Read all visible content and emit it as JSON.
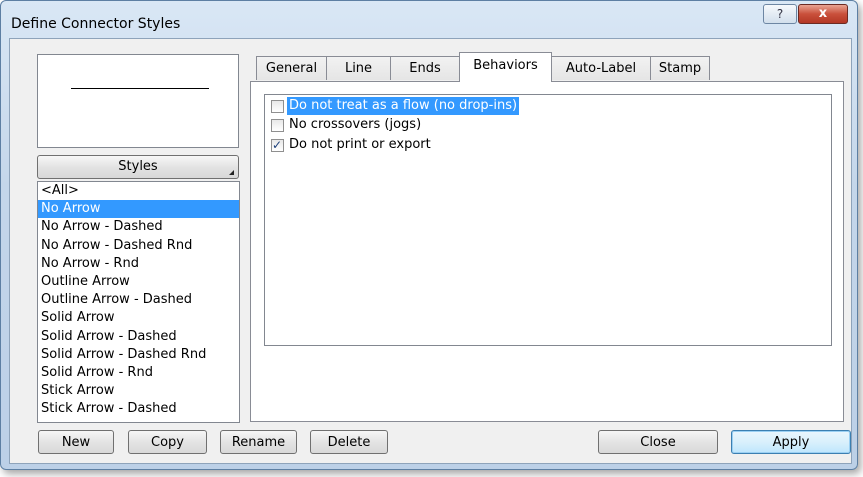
{
  "window": {
    "title": "Define Connector Styles",
    "help_glyph": "?",
    "close_glyph": "x"
  },
  "styles_button": {
    "label": "Styles"
  },
  "style_list": {
    "selected": "No Arrow",
    "items": [
      "<All>",
      "No Arrow",
      "No Arrow - Dashed",
      "No Arrow - Dashed Rnd",
      "No Arrow - Rnd",
      "Outline Arrow",
      "Outline Arrow - Dashed",
      "Solid Arrow",
      "Solid Arrow - Dashed",
      "Solid Arrow - Dashed Rnd",
      "Solid Arrow - Rnd",
      "Stick Arrow",
      "Stick Arrow - Dashed"
    ]
  },
  "tabs": [
    {
      "label": "General",
      "active": false
    },
    {
      "label": "Line",
      "active": false
    },
    {
      "label": "Ends",
      "active": false
    },
    {
      "label": "Behaviors",
      "active": true
    },
    {
      "label": "Auto-Label",
      "active": false
    },
    {
      "label": "Stamp",
      "active": false
    }
  ],
  "behaviors": [
    {
      "label": "Do not treat as a flow (no drop-ins)",
      "checked": false,
      "highlighted": true
    },
    {
      "label": "No crossovers (jogs)",
      "checked": false,
      "highlighted": false
    },
    {
      "label": "Do not print or export",
      "checked": true,
      "highlighted": false
    }
  ],
  "buttons": {
    "new": "New",
    "copy": "Copy",
    "rename": "Rename",
    "delete": "Delete",
    "close": "Close",
    "apply": "Apply"
  },
  "colors": {
    "selection": "#3399ff",
    "title_close": "#c9503b",
    "default_button": "#d9f0fc"
  }
}
